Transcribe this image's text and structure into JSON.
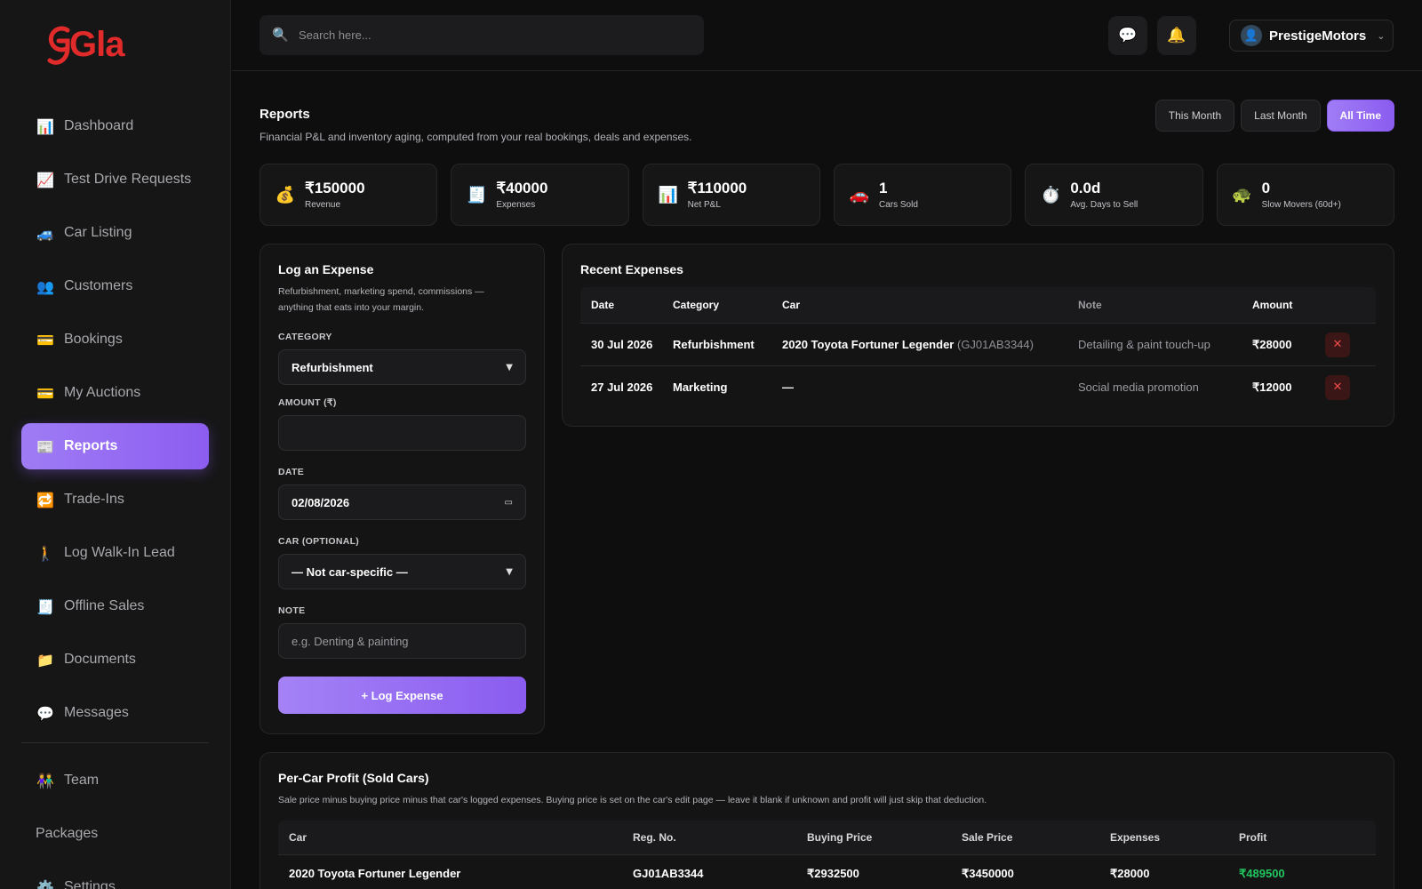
{
  "brand": {
    "logo_text": "Gla"
  },
  "sidebar": {
    "items": [
      {
        "label": "Dashboard",
        "icon": "bar-chart-icon",
        "glyph": "📊"
      },
      {
        "label": "Test Drive Requests",
        "icon": "line-chart-icon",
        "glyph": "📈"
      },
      {
        "label": "Car Listing",
        "icon": "car-icon",
        "glyph": "🚙"
      },
      {
        "label": "Customers",
        "icon": "users-icon",
        "glyph": "👥"
      },
      {
        "label": "Bookings",
        "icon": "credit-card-icon",
        "glyph": "💳"
      },
      {
        "label": "My Auctions",
        "icon": "credit-card-icon",
        "glyph": "💳"
      },
      {
        "label": "Reports",
        "icon": "newspaper-icon",
        "glyph": "📰"
      },
      {
        "label": "Trade-Ins",
        "icon": "repeat-icon",
        "glyph": "🔁"
      },
      {
        "label": "Log Walk-In Lead",
        "icon": "walking-person-icon",
        "glyph": "🚶"
      },
      {
        "label": "Offline Sales",
        "icon": "receipt-icon",
        "glyph": "🧾"
      },
      {
        "label": "Documents",
        "icon": "folder-icon",
        "glyph": "📁"
      },
      {
        "label": "Messages",
        "icon": "speech-bubble-icon",
        "glyph": "💬"
      }
    ],
    "secondary": [
      {
        "label": "Team",
        "icon": "team-icon",
        "glyph": "👫"
      },
      {
        "label": "Packages"
      },
      {
        "label": "Settings",
        "icon": "gear-icon",
        "glyph": "⚙️"
      }
    ]
  },
  "header": {
    "search_placeholder": "Search here...",
    "user_name": "PrestigeMotors"
  },
  "page": {
    "title": "Reports",
    "subtitle": "Financial P&L and inventory aging, computed from your real bookings, deals and expenses.",
    "ranges": [
      "This Month",
      "Last Month",
      "All Time"
    ]
  },
  "stats": [
    {
      "value": "₹150000",
      "label": "Revenue",
      "icon": "money-bag-icon",
      "glyph": "💰"
    },
    {
      "value": "₹40000",
      "label": "Expenses",
      "icon": "receipt-icon",
      "glyph": "🧾"
    },
    {
      "value": "₹110000",
      "label": "Net P&L",
      "icon": "bar-chart-icon",
      "glyph": "📊"
    },
    {
      "value": "1",
      "label": "Cars Sold",
      "icon": "car-icon",
      "glyph": "🚗"
    },
    {
      "value": "0.0d",
      "label": "Avg. Days to Sell",
      "icon": "stopwatch-icon",
      "glyph": "⏱️"
    },
    {
      "value": "0",
      "label": "Slow Movers (60d+)",
      "icon": "turtle-icon",
      "glyph": "🐢"
    }
  ],
  "expense_form": {
    "title": "Log an Expense",
    "subtitle": "Refurbishment, marketing spend, commissions — anything that eats into your margin.",
    "category_label": "CATEGORY",
    "category_value": "Refurbishment",
    "amount_label": "AMOUNT (₹)",
    "amount_value": "",
    "date_label": "DATE",
    "date_value": "02/08/2026",
    "car_label": "CAR (OPTIONAL)",
    "car_value": "— Not car-specific —",
    "note_label": "NOTE",
    "note_placeholder": "e.g. Denting & painting",
    "submit_label": "+ Log Expense"
  },
  "recent_expenses": {
    "title": "Recent Expenses",
    "columns": [
      "Date",
      "Category",
      "Car",
      "Note",
      "Amount"
    ],
    "rows": [
      {
        "date": "30 Jul 2026",
        "category": "Refurbishment",
        "car": "2020 Toyota Fortuner Legender",
        "reg": "(GJ01AB3344)",
        "note": "Detailing & paint touch-up",
        "amount": "₹28000"
      },
      {
        "date": "27 Jul 2026",
        "category": "Marketing",
        "car": "—",
        "reg": "",
        "note": "Social media promotion",
        "amount": "₹12000"
      }
    ]
  },
  "per_car_profit": {
    "title": "Per-Car Profit (Sold Cars)",
    "subtitle": "Sale price minus buying price minus that car's logged expenses. Buying price is set on the car's edit page — leave it blank if unknown and profit will just skip that deduction.",
    "columns": [
      "Car",
      "Reg. No.",
      "Buying Price",
      "Sale Price",
      "Expenses",
      "Profit"
    ],
    "rows": [
      {
        "car": "2020 Toyota Fortuner Legender",
        "reg": "GJ01AB3344",
        "buying": "₹2932500",
        "sale": "₹3450000",
        "expenses": "₹28000",
        "profit": "₹489500"
      }
    ]
  },
  "colors": {
    "accent": "#8c5df0",
    "brand": "#e12a2a",
    "profit": "#22c55e",
    "danger": "#f14a4a"
  }
}
